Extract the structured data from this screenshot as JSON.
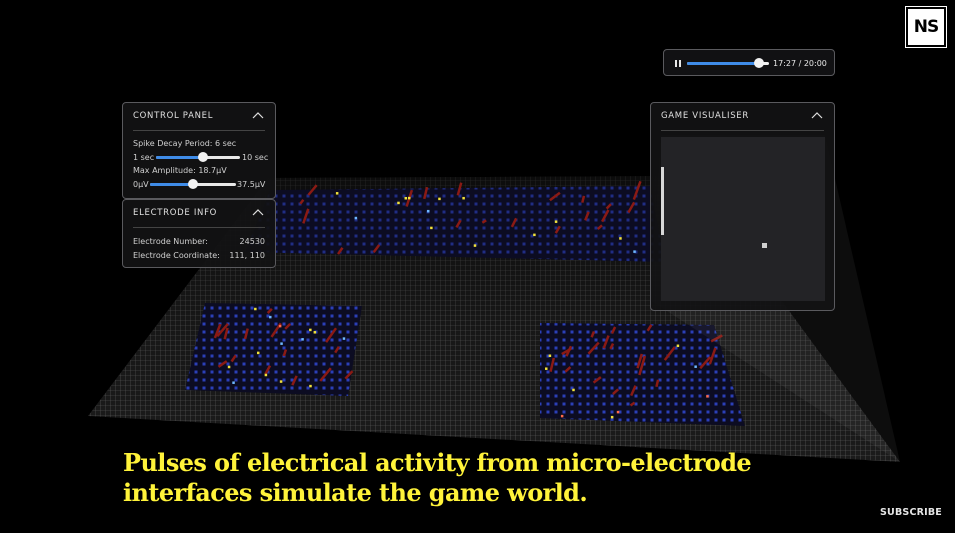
{
  "video": {
    "caption": "Pulses of electrical activity from micro-electrode interfaces simulate the game world.",
    "time_display": "17:27 / 20:00",
    "progress_fraction": 0.873,
    "subscribe_label": "SUBSCRIBE",
    "logo_text": "NS",
    "pause_icon": "pause-icon"
  },
  "control_panel": {
    "title": "CONTROL PANEL",
    "spike_decay_label": "Spike Decay Period: 6 sec",
    "spike_decay_min": "1 sec",
    "spike_decay_max": "10 sec",
    "spike_decay_value": 6,
    "spike_decay_range": [
      1,
      10
    ],
    "max_amplitude_label": "Max Amplitude: 18.7μV",
    "max_amplitude_min": "0μV",
    "max_amplitude_max": "37.5μV",
    "max_amplitude_value": 18.7,
    "max_amplitude_range": [
      0,
      37.5
    ]
  },
  "electrode_info": {
    "title": "ELECTRODE INFO",
    "number_label": "Electrode Number:",
    "number_value": "24530",
    "coordinate_label": "Electrode Coordinate:",
    "coordinate_value": "111, 110"
  },
  "game_visualiser": {
    "title": "GAME VISUALISER"
  },
  "colors": {
    "caption": "#fff33a",
    "slider_fill": "#3f8ce8",
    "electrode_blue": "#2b3fb8",
    "spike_red": "#8a1a14",
    "spike_yellow": "#f2e23a"
  }
}
